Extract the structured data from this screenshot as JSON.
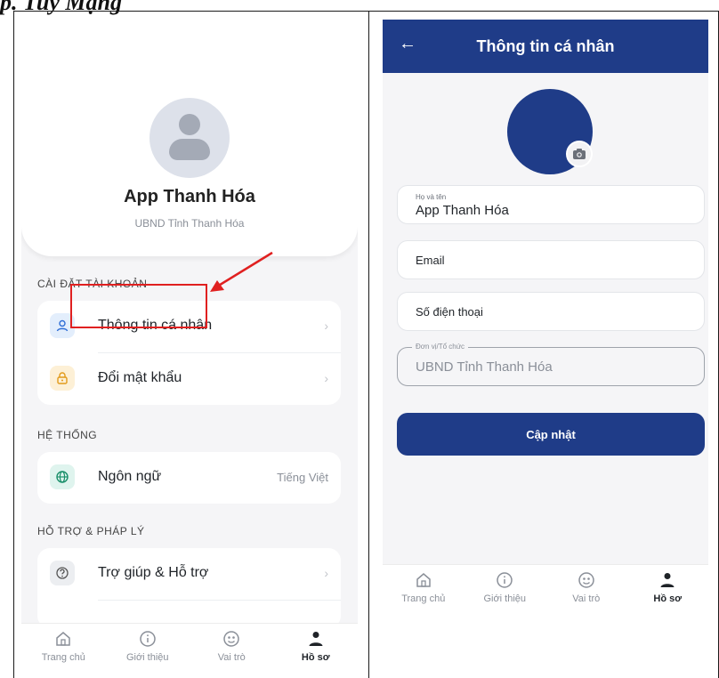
{
  "document": {
    "heading": "p. Tuy Mạng"
  },
  "left_screen": {
    "profile": {
      "name": "App Thanh Hóa",
      "org": "UBND Tỉnh Thanh Hóa"
    },
    "sections": {
      "account": {
        "title": "CÀI ĐẶT TÀI KHOẢN",
        "items": [
          {
            "label": "Thông tin cá nhân",
            "icon": "user-icon",
            "highlighted": true
          },
          {
            "label": "Đổi mật khẩu",
            "icon": "lock-icon"
          }
        ]
      },
      "system": {
        "title": "HỆ THỐNG",
        "items": [
          {
            "label": "Ngôn ngữ",
            "value": "Tiếng Việt",
            "icon": "globe-icon"
          }
        ]
      },
      "support": {
        "title": "HỖ TRỢ & PHÁP LÝ",
        "items": [
          {
            "label": "Trợ giúp & Hỗ trợ",
            "icon": "help-icon"
          }
        ]
      }
    }
  },
  "right_screen": {
    "title": "Thông tin cá nhân",
    "fields": {
      "name": {
        "label": "Họ và tên",
        "value": "App Thanh Hóa"
      },
      "email": {
        "placeholder": "Email"
      },
      "phone": {
        "placeholder": "Số điện thoại"
      },
      "org": {
        "label": "Đơn vị/Tổ chức",
        "value": "UBND Tỉnh Thanh Hóa"
      }
    },
    "update_button": "Cập nhật"
  },
  "tabbar": {
    "tabs": [
      {
        "label": "Trang chủ",
        "icon": "home-icon"
      },
      {
        "label": "Giới thiệu",
        "icon": "info-icon"
      },
      {
        "label": "Vai trò",
        "icon": "role-icon"
      },
      {
        "label": "Hồ sơ",
        "icon": "profile-icon",
        "active": true
      }
    ]
  },
  "colors": {
    "primary": "#1f3c88",
    "highlight": "#e02020",
    "background": "#f5f5f7"
  }
}
